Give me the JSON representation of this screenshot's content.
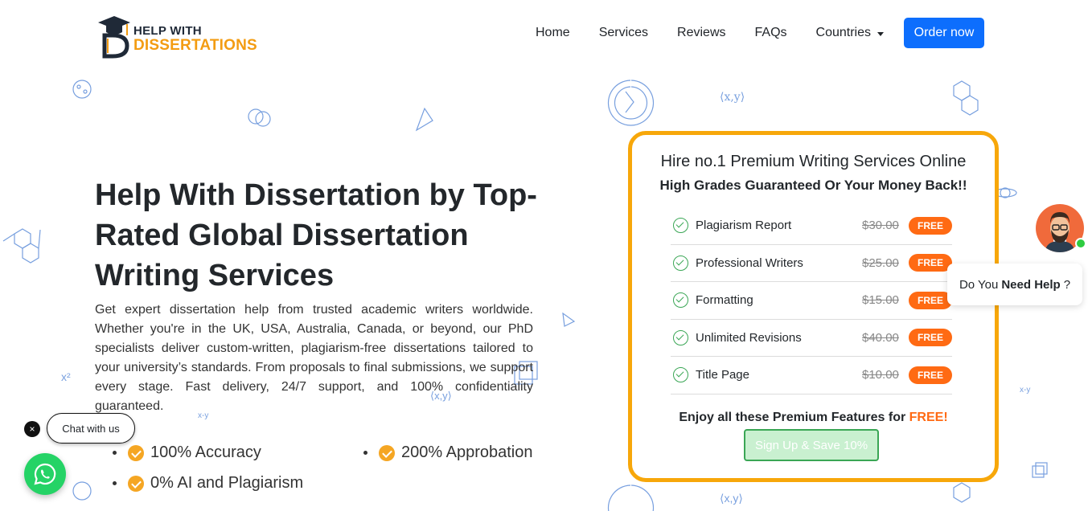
{
  "brand": {
    "line1": "HELP WITH",
    "line2": "DISSERTATIONS",
    "accent_color": "#f39c12"
  },
  "nav": {
    "items": [
      "Home",
      "Services",
      "Reviews",
      "FAQs"
    ],
    "countries_label": "Countries",
    "order_label": "Order now",
    "order_color": "#0d6efd"
  },
  "hero": {
    "title": "Help With Dissertation by Top-Rated Global Dissertation Writing Services",
    "description": "Get expert dissertation help from trusted academic writers worldwide. Whether you're in the UK, USA, Australia, Canada, or beyond, our PhD specialists deliver custom-written, plagiarism-free dissertations tailored to your university’s standards. From proposals to final submissions, we support every stage. Fast delivery, 24/7 support, and 100% confidentiality guaranteed.",
    "bullets": [
      "100% Accuracy",
      "200% Approbation",
      "0% AI and Plagiarism"
    ]
  },
  "offer": {
    "heading": "Hire no.1 Premium Writing Services Online",
    "subheading": "High Grades Guaranteed Or Your Money Back!!",
    "features": [
      {
        "name": "Plagiarism Report",
        "price": "$30.00",
        "badge": "FREE"
      },
      {
        "name": "Professional Writers",
        "price": "$25.00",
        "badge": "FREE"
      },
      {
        "name": "Formatting",
        "price": "$15.00",
        "badge": "FREE"
      },
      {
        "name": "Unlimited Revisions",
        "price": "$40.00",
        "badge": "FREE"
      },
      {
        "name": "Title Page",
        "price": "$10.00",
        "badge": "FREE"
      }
    ],
    "enjoy_text": "Enjoy all these Premium Features for",
    "enjoy_free": "FREE!",
    "signup_label": "Sign Up & Save 10%",
    "border_color": "#f7a70a",
    "badge_color": "#ff6a13"
  },
  "help_widget": {
    "prefix": "Do You",
    "bold": "Need Help",
    "suffix": "?"
  },
  "chat_widget": {
    "label": "Chat with us",
    "close_glyph": "×",
    "icon": "whatsapp-icon"
  }
}
